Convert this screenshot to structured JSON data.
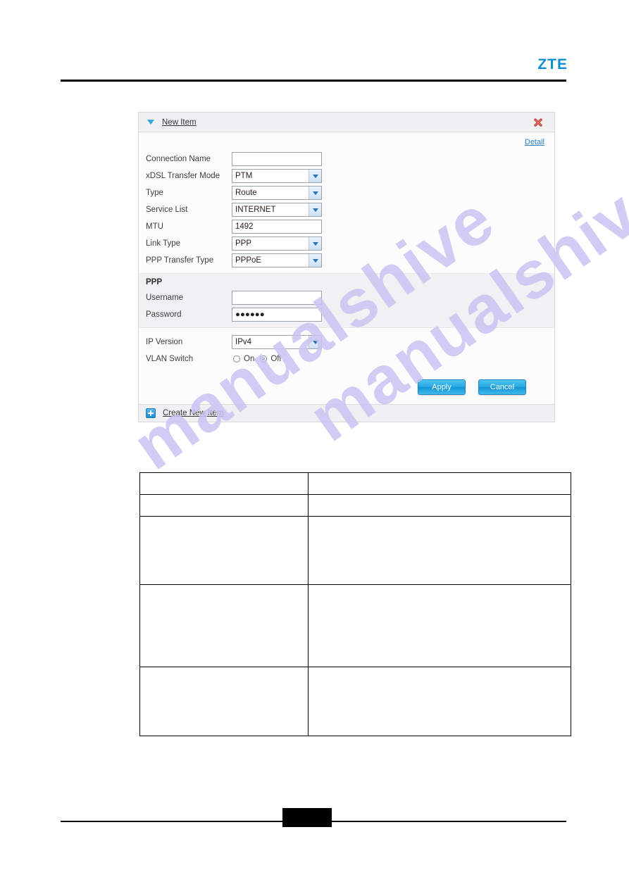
{
  "page": {
    "brand": "ZTE",
    "page_number_redacted": true
  },
  "panel": {
    "collapse_icon": "triangle-down-icon",
    "title": "New Item",
    "close_icon": "close-x-icon",
    "detail_link": "Detail",
    "fields": [
      {
        "label": "Connection Name",
        "type": "text",
        "value": ""
      },
      {
        "label": "xDSL Transfer Mode",
        "type": "select",
        "value": "PTM"
      },
      {
        "label": "Type",
        "type": "select",
        "value": "Route"
      },
      {
        "label": "Service List",
        "type": "select",
        "value": "INTERNET"
      },
      {
        "label": "MTU",
        "type": "text",
        "value": "1492"
      },
      {
        "label": "Link Type",
        "type": "select",
        "value": "PPP"
      },
      {
        "label": "PPP Transfer Type",
        "type": "select",
        "value": "PPPoE"
      }
    ],
    "ppp": {
      "heading": "PPP",
      "username_label": "Username",
      "username_value": "",
      "password_label": "Password",
      "password_value": "●●●●●●"
    },
    "ip_version": {
      "label": "IP Version",
      "value": "IPv4"
    },
    "vlan_switch": {
      "label": "VLAN Switch",
      "options": [
        {
          "label": "On",
          "selected": false
        },
        {
          "label": "Off",
          "selected": true
        }
      ]
    },
    "buttons": {
      "apply": "Apply",
      "cancel": "Cancel"
    },
    "footer": {
      "plus_icon": "plus-square-icon",
      "create_label": "Create New Item"
    }
  },
  "spec_table": {
    "rows": [
      {
        "col_a": "",
        "col_b": ""
      },
      {
        "col_a": "",
        "col_b": ""
      },
      {
        "col_a": "",
        "col_b": ""
      },
      {
        "col_a": "",
        "col_b": ""
      },
      {
        "col_a": "",
        "col_b": ""
      }
    ]
  },
  "watermark": {
    "line_a": "manualshive",
    "line_b": "manualshive.com"
  },
  "colors": {
    "brand_blue": "#0f8fd0",
    "link_blue": "#2a7fc4",
    "button_blue": "#27a8e2",
    "close_red": "#c0392b",
    "radio_green": "#2b9a63",
    "watermark": "#c9c4f2"
  }
}
